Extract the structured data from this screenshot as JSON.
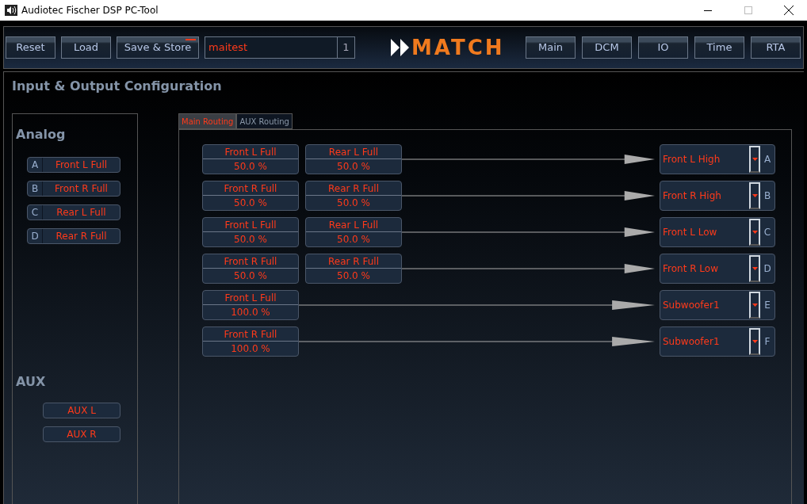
{
  "window": {
    "title": "Audiotec Fischer DSP PC-Tool"
  },
  "toolbar": {
    "buttons": [
      {
        "label": "Reset",
        "unsaved": false
      },
      {
        "label": "Load",
        "unsaved": false
      },
      {
        "label": "Save & Store",
        "unsaved": true
      }
    ],
    "setup_name": "maitest",
    "setup_number": "1",
    "logo": "MATCH",
    "nav": [
      {
        "label": "Main"
      },
      {
        "label": "DCM"
      },
      {
        "label": "IO"
      },
      {
        "label": "Time"
      },
      {
        "label": "RTA"
      }
    ]
  },
  "page": {
    "title": "Input & Output Configuration"
  },
  "inputs": {
    "analog_title": "Analog",
    "analog": [
      {
        "letter": "A",
        "name": "Front L Full"
      },
      {
        "letter": "B",
        "name": "Front R Full"
      },
      {
        "letter": "C",
        "name": "Rear L Full"
      },
      {
        "letter": "D",
        "name": "Rear R Full"
      }
    ],
    "aux_title": "AUX",
    "aux": [
      "AUX L",
      "AUX R"
    ]
  },
  "tabs": [
    {
      "label": "Main Routing",
      "selected": true
    },
    {
      "label": "AUX Routing",
      "selected": false
    }
  ],
  "routes": [
    {
      "sources": [
        {
          "name": "Front L Full",
          "share": "50.0 %"
        },
        {
          "name": "Rear L Full",
          "share": "50.0 %"
        }
      ],
      "output": "Front L High",
      "channel": "A"
    },
    {
      "sources": [
        {
          "name": "Front R Full",
          "share": "50.0 %"
        },
        {
          "name": "Rear R Full",
          "share": "50.0 %"
        }
      ],
      "output": "Front R High",
      "channel": "B"
    },
    {
      "sources": [
        {
          "name": "Front L Full",
          "share": "50.0 %"
        },
        {
          "name": "Rear L Full",
          "share": "50.0 %"
        }
      ],
      "output": "Front L Low",
      "channel": "C"
    },
    {
      "sources": [
        {
          "name": "Front R Full",
          "share": "50.0 %"
        },
        {
          "name": "Rear R Full",
          "share": "50.0 %"
        }
      ],
      "output": "Front R Low",
      "channel": "D"
    },
    {
      "sources": [
        {
          "name": "Front L Full",
          "share": "100.0 %"
        }
      ],
      "output": "Subwoofer1",
      "channel": "E"
    },
    {
      "sources": [
        {
          "name": "Front R Full",
          "share": "100.0 %"
        }
      ],
      "output": "Subwoofer1",
      "channel": "F"
    }
  ]
}
